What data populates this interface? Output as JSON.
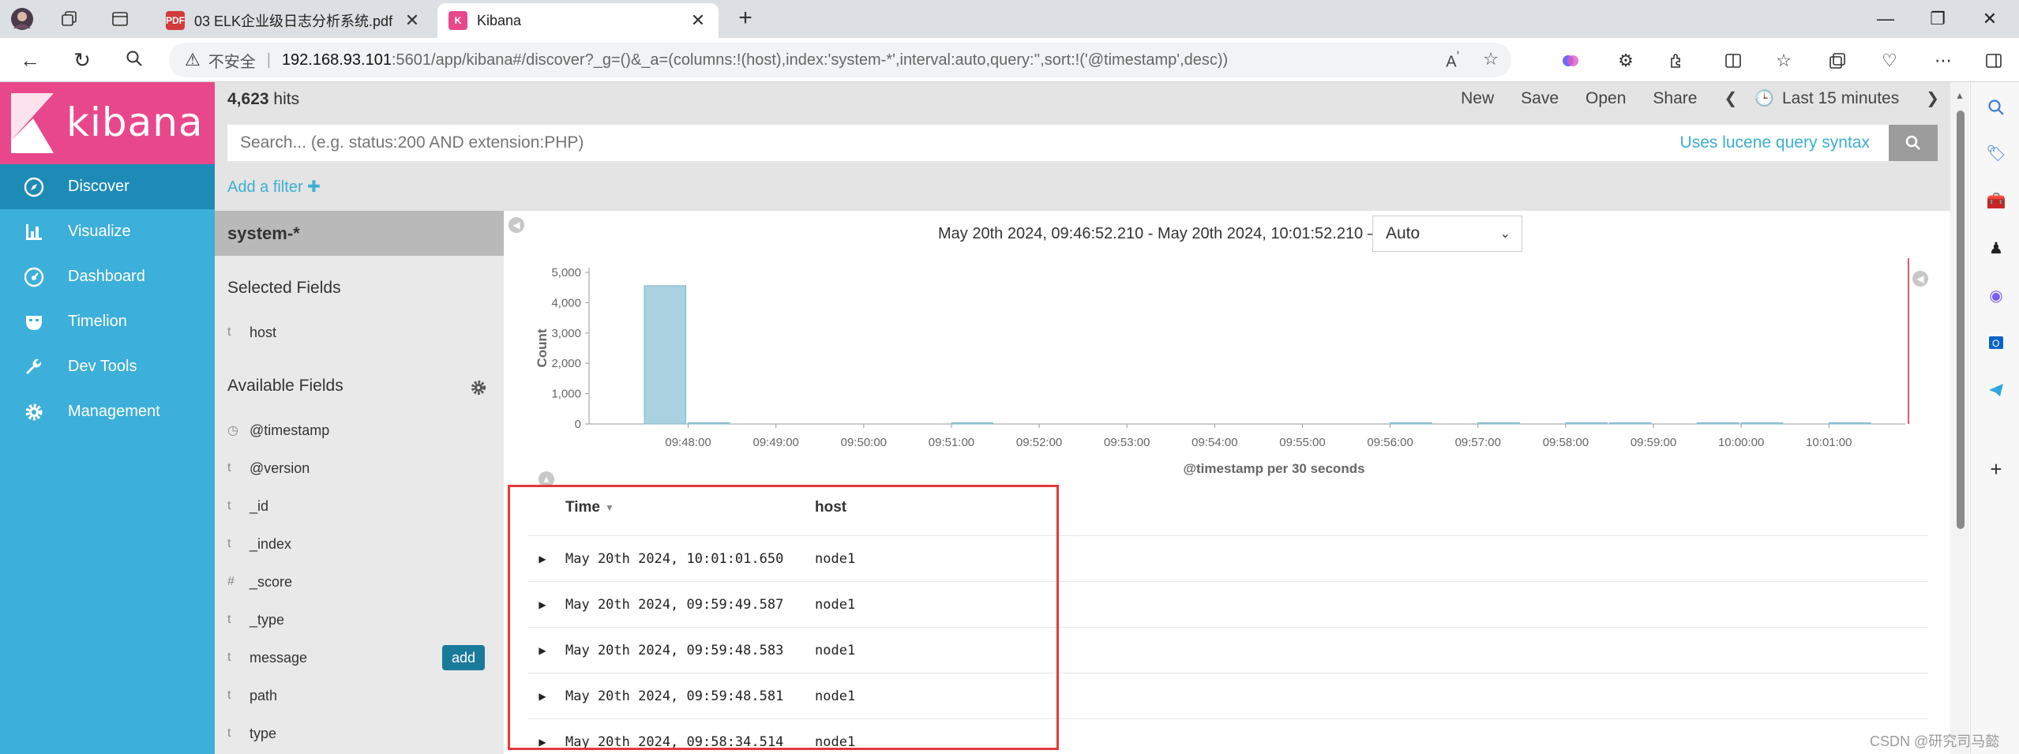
{
  "browser": {
    "tabs": [
      {
        "title": "03 ELK企业级日志分析系统.pdf",
        "favicon": "PDF",
        "active": false
      },
      {
        "title": "Kibana",
        "favicon": "K",
        "active": true
      }
    ],
    "url": {
      "security_label": "不安全",
      "separator": "|",
      "host": "192.168.93.101",
      "rest": ":5601/app/kibana#/discover?_g=()&_a=(columns:!(host),index:'system-*',interval:auto,query:'',sort:!('@timestamp',desc))"
    }
  },
  "kibana": {
    "logo_text": "kibana",
    "brand_color": "#e8488b",
    "nav": [
      {
        "label": "Discover",
        "icon": "compass-icon",
        "active": true
      },
      {
        "label": "Visualize",
        "icon": "bar-chart-icon",
        "active": false
      },
      {
        "label": "Dashboard",
        "icon": "dashboard-gauge-icon",
        "active": false
      },
      {
        "label": "Timelion",
        "icon": "timelion-mask-icon",
        "active": false
      },
      {
        "label": "Dev Tools",
        "icon": "wrench-icon",
        "active": false
      },
      {
        "label": "Management",
        "icon": "gear-icon",
        "active": false
      }
    ],
    "hits": {
      "count": "4,623",
      "label": "hits"
    },
    "top_menu": {
      "new": "New",
      "save": "Save",
      "open": "Open",
      "share": "Share",
      "time_label": "Last 15 minutes"
    },
    "search": {
      "placeholder": "Search... (e.g. status:200 AND extension:PHP)",
      "value": "",
      "lucene": "Uses lucene query syntax"
    },
    "add_filter": "Add a filter",
    "index_pattern": "system-*",
    "selected_fields_title": "Selected Fields",
    "selected_fields": [
      {
        "type": "t",
        "name": "host"
      }
    ],
    "available_fields_title": "Available Fields",
    "available_fields": [
      {
        "type": "clock",
        "name": "@timestamp"
      },
      {
        "type": "t",
        "name": "@version"
      },
      {
        "type": "t",
        "name": "_id"
      },
      {
        "type": "t",
        "name": "_index"
      },
      {
        "type": "#",
        "name": "_score"
      },
      {
        "type": "t",
        "name": "_type"
      },
      {
        "type": "t",
        "name": "message",
        "action": "add"
      },
      {
        "type": "t",
        "name": "path"
      },
      {
        "type": "t",
        "name": "type"
      }
    ],
    "time_range_text": "May 20th 2024, 09:46:52.210 - May 20th 2024, 10:01:52.210 —",
    "interval": "Auto",
    "table": {
      "headers": [
        "Time",
        "host"
      ],
      "rows": [
        {
          "time": "May 20th 2024, 10:01:01.650",
          "host": "node1"
        },
        {
          "time": "May 20th 2024, 09:59:49.587",
          "host": "node1"
        },
        {
          "time": "May 20th 2024, 09:59:48.583",
          "host": "node1"
        },
        {
          "time": "May 20th 2024, 09:59:48.581",
          "host": "node1"
        },
        {
          "time": "May 20th 2024, 09:58:34.514",
          "host": "node1"
        }
      ]
    }
  },
  "chart_data": {
    "type": "bar",
    "xlabel": "@timestamp per 30 seconds",
    "ylabel": "Count",
    "ylim": [
      0,
      5000
    ],
    "yticks": [
      "0",
      "1,000",
      "2,000",
      "3,000",
      "4,000",
      "5,000"
    ],
    "xticks": [
      "09:48:00",
      "09:49:00",
      "09:50:00",
      "09:51:00",
      "09:52:00",
      "09:53:00",
      "09:54:00",
      "09:55:00",
      "09:56:00",
      "09:57:00",
      "09:58:00",
      "09:59:00",
      "10:00:00",
      "10:01:00"
    ],
    "series": [
      {
        "values": [
          {
            "x": "09:47:30",
            "y": 4560
          },
          {
            "x": "09:48:00",
            "y": 8
          },
          {
            "x": "09:51:00",
            "y": 4
          },
          {
            "x": "09:56:00",
            "y": 6
          },
          {
            "x": "09:57:00",
            "y": 4
          },
          {
            "x": "09:58:00",
            "y": 12
          },
          {
            "x": "09:58:30",
            "y": 4
          },
          {
            "x": "09:59:30",
            "y": 14
          },
          {
            "x": "10:00:00",
            "y": 2
          },
          {
            "x": "10:01:00",
            "y": 6
          }
        ]
      }
    ],
    "bar_color": "#a9d1df",
    "now_marker_color": "#e05c6c",
    "grid": false
  },
  "watermark": "CSDN @研究司马懿",
  "colors": {
    "nav_bg": "#3cafda",
    "nav_active": "#1e8bb7",
    "link": "#3caed2",
    "red_box": "#e33a3a"
  }
}
